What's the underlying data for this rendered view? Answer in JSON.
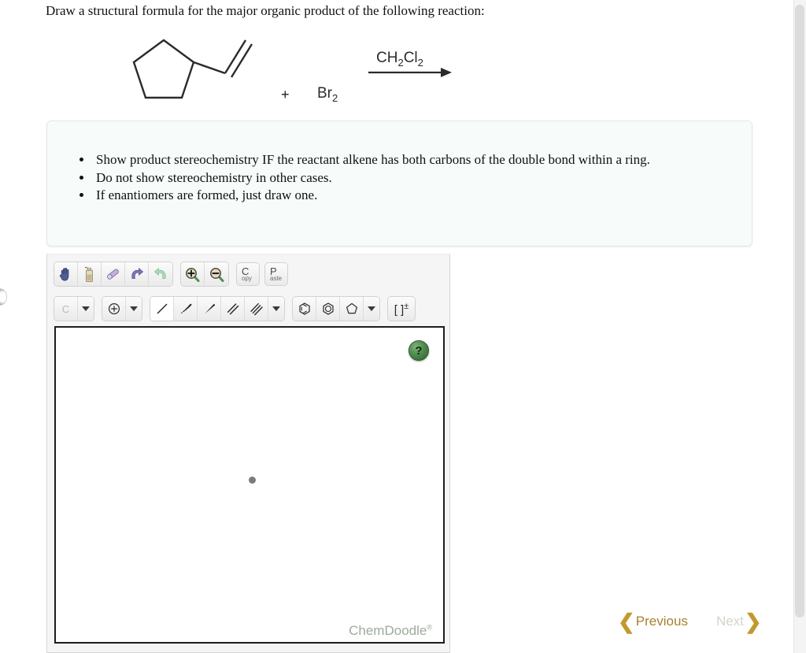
{
  "prompt": {
    "text": "Draw a structural formula for the major organic product of the following reaction:"
  },
  "reaction": {
    "reactant_name": "vinylcyclopentane-structure",
    "plus": "+",
    "reagent": "Br",
    "reagent_sub": "2",
    "solvent_pre": "CH",
    "solvent_sub1": "2",
    "solvent_mid": "Cl",
    "solvent_sub2": "2",
    "arrow_name": "reaction-arrow"
  },
  "instructions": {
    "items": [
      "Show product stereochemistry IF the reactant alkene has both carbons of the double bond within a ring.",
      "Do not show stereochemistry in other cases.",
      "If enantiomers are formed, just draw one."
    ]
  },
  "sketcher": {
    "toolbar_row1": [
      {
        "name": "pan-hand-tool",
        "icon": "hand-icon",
        "selected": false
      },
      {
        "name": "clear-tool",
        "icon": "spray-bottle-icon",
        "selected": false
      },
      {
        "name": "eraser-tool",
        "icon": "eraser-icon",
        "selected": false
      },
      {
        "name": "undo-button",
        "icon": "undo-arrow-icon",
        "selected": false
      },
      {
        "name": "redo-button",
        "icon": "redo-arrow-icon",
        "selected": false
      },
      {
        "name": "zoom-in-button",
        "icon": "magnifier-plus-icon",
        "selected": false
      },
      {
        "name": "zoom-out-button",
        "icon": "magnifier-minus-icon",
        "selected": false
      }
    ],
    "copy_label_big": "C",
    "copy_label_small": "opy",
    "paste_label_big": "P",
    "paste_label_small": "aste",
    "element_label": "C",
    "charge_glyph": "⊕",
    "bracket_label": "[ ]",
    "bracket_sup": "±",
    "toolbar_row2": [
      {
        "name": "element-picker",
        "label": "C"
      },
      {
        "name": "charge-tool",
        "label": "⊕"
      },
      {
        "name": "single-bond-tool",
        "selected": true
      },
      {
        "name": "hashed-wedge-bond-tool",
        "selected": false
      },
      {
        "name": "bold-wedge-bond-tool",
        "selected": false
      },
      {
        "name": "double-bond-tool",
        "selected": false
      },
      {
        "name": "triple-bond-tool",
        "selected": false
      },
      {
        "name": "benzene-ring-tool",
        "selected": false
      },
      {
        "name": "aromatic-ring-tool",
        "selected": false
      },
      {
        "name": "cyclopentane-ring-tool",
        "selected": false
      }
    ],
    "help_label": "?",
    "watermark": "ChemDoodle",
    "watermark_sup": "®"
  },
  "navigation": {
    "previous_label": "Previous",
    "next_label": "Next",
    "prev_chevron": "❮",
    "next_chevron": "❯"
  },
  "colors": {
    "note_bg": "#f7fbf9",
    "note_border": "#e2e8e5",
    "prev_text": "#a9802f",
    "next_text": "#d6d3cd",
    "chevron": "#c3992f",
    "watermark": "#9cab9c",
    "help_green": "#4e8a4e",
    "atom_dot": "#7a7a82"
  }
}
